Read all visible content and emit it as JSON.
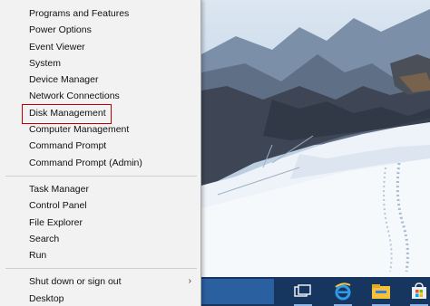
{
  "context_menu": {
    "group1": [
      {
        "label": "Programs and Features"
      },
      {
        "label": "Power Options"
      },
      {
        "label": "Event Viewer"
      },
      {
        "label": "System"
      },
      {
        "label": "Device Manager"
      },
      {
        "label": "Network Connections"
      },
      {
        "label": "Disk Management",
        "highlighted": true
      },
      {
        "label": "Computer Management"
      },
      {
        "label": "Command Prompt"
      },
      {
        "label": "Command Prompt (Admin)"
      }
    ],
    "group2": [
      {
        "label": "Task Manager"
      },
      {
        "label": "Control Panel"
      },
      {
        "label": "File Explorer"
      },
      {
        "label": "Search"
      },
      {
        "label": "Run"
      }
    ],
    "group3": [
      {
        "label": "Shut down or sign out",
        "submenu": true
      },
      {
        "label": "Desktop"
      }
    ],
    "highlight_color": "#c00000"
  },
  "taskbar": {
    "color": "#17365f",
    "icons": [
      "task-view-icon",
      "internet-explorer-icon",
      "file-explorer-icon",
      "store-icon"
    ]
  }
}
